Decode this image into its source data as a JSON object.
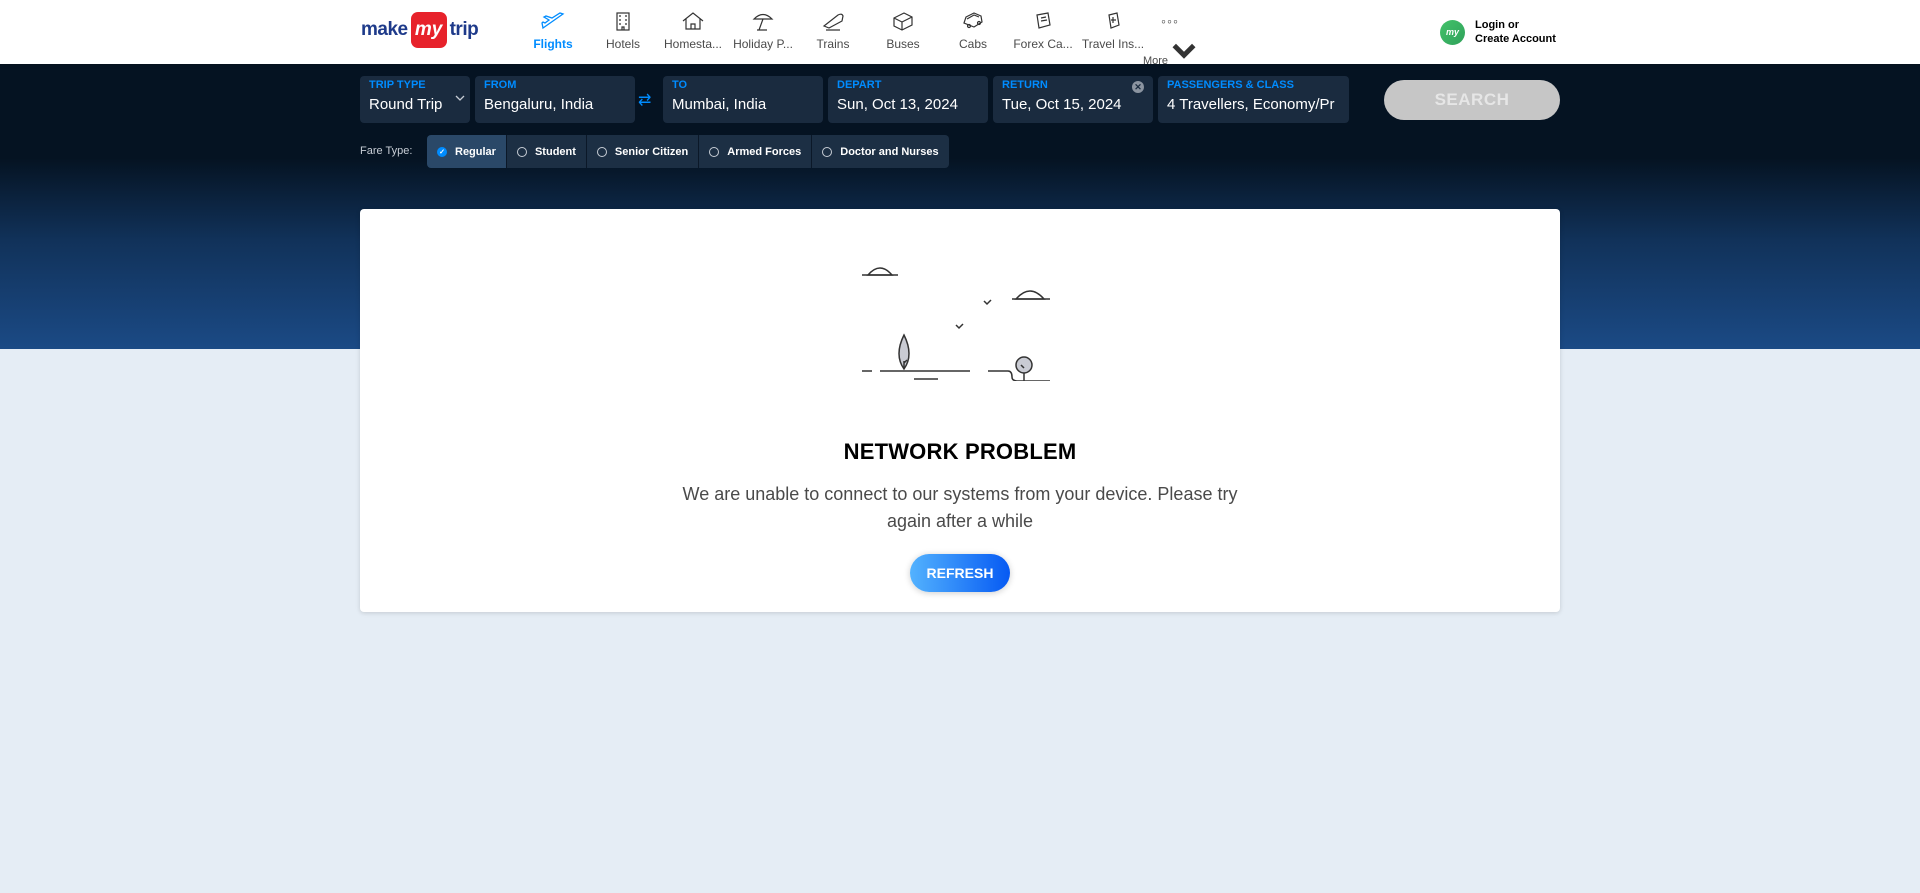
{
  "brand": {
    "part1": "make",
    "part2": "my",
    "part3": "trip"
  },
  "nav": {
    "items": [
      {
        "label": "Flights",
        "icon": "flight-icon",
        "active": true
      },
      {
        "label": "Hotels",
        "icon": "hotel-icon"
      },
      {
        "label": "Homesta...",
        "icon": "homestay-icon"
      },
      {
        "label": "Holiday P...",
        "icon": "holiday-package-icon"
      },
      {
        "label": "Trains",
        "icon": "train-icon"
      },
      {
        "label": "Buses",
        "icon": "bus-icon"
      },
      {
        "label": "Cabs",
        "icon": "cab-icon"
      },
      {
        "label": "Forex Ca...",
        "icon": "forex-card-icon"
      },
      {
        "label": "Travel Ins...",
        "icon": "travel-insurance-icon"
      }
    ],
    "more_label": "More",
    "more_dots": "◦◦◦"
  },
  "login": {
    "avatar_text": "my",
    "line1": "Login or",
    "line2": "Create Account"
  },
  "search": {
    "trip_type": {
      "label": "TRIP TYPE",
      "value": "Round Trip"
    },
    "from": {
      "label": "FROM",
      "value": "Bengaluru, India"
    },
    "to": {
      "label": "TO",
      "value": "Mumbai, India"
    },
    "depart": {
      "label": "DEPART",
      "value": "Sun, Oct 13, 2024"
    },
    "return": {
      "label": "RETURN",
      "value": "Tue, Oct 15, 2024"
    },
    "passengers": {
      "label": "PASSENGERS & CLASS",
      "value": "4 Travellers, Economy/Pr"
    },
    "swap_symbol": "⇄",
    "clear_symbol": "✕",
    "button_label": "SEARCH"
  },
  "fare_type": {
    "label": "Fare Type:",
    "options": [
      {
        "label": "Regular",
        "selected": true
      },
      {
        "label": "Student"
      },
      {
        "label": "Senior Citizen"
      },
      {
        "label": "Armed Forces"
      },
      {
        "label": "Doctor and Nurses"
      }
    ],
    "check_symbol": "✓"
  },
  "error": {
    "title": "NETWORK PROBLEM",
    "message": "We are unable to connect to our systems from your device. Please try again after a while",
    "button_label": "REFRESH"
  },
  "colors": {
    "accent": "#008cff",
    "brand_red": "#e7222b",
    "dark_navy": "#051322"
  }
}
